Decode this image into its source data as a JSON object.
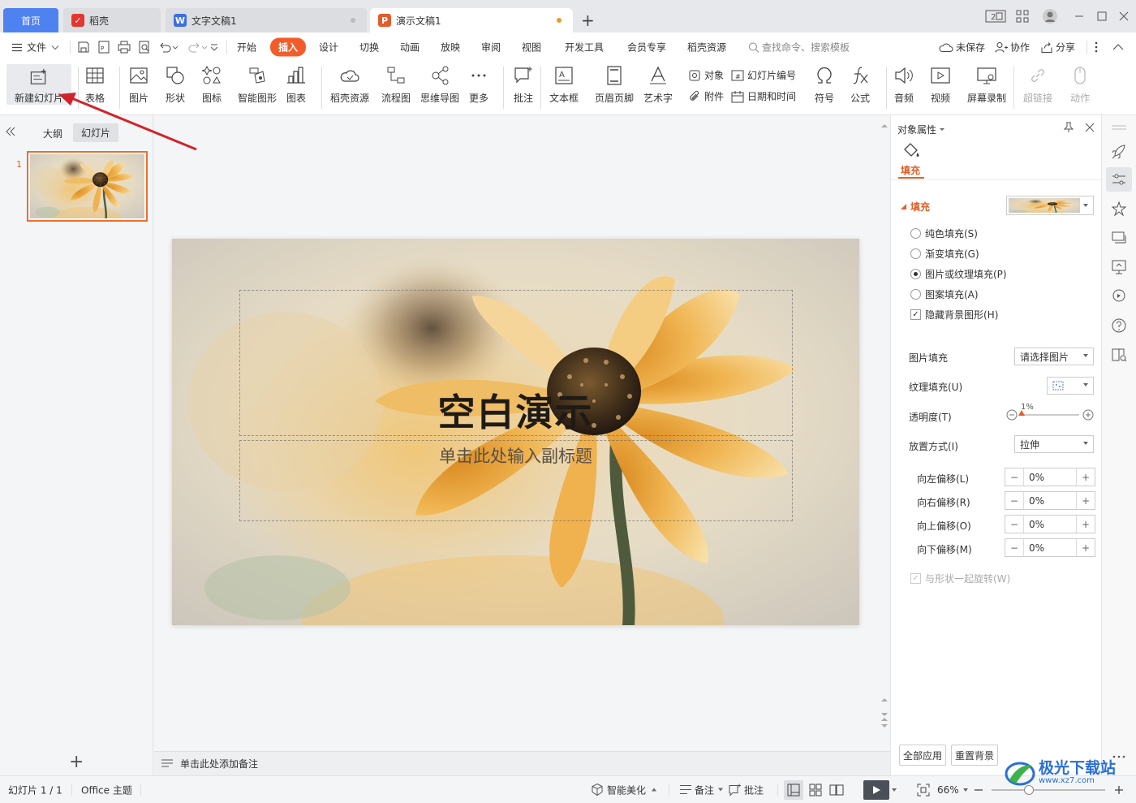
{
  "titlebar": {
    "tabs": [
      {
        "label": "首页"
      },
      {
        "label": "稻壳"
      },
      {
        "label": "文字文稿1"
      },
      {
        "label": "演示文稿1"
      }
    ],
    "new_tab_symbol": "+"
  },
  "menu": {
    "file": "文件",
    "items": [
      "开始",
      "插入",
      "设计",
      "切换",
      "动画",
      "放映",
      "审阅",
      "视图",
      "开发工具",
      "会员专享",
      "稻壳资源"
    ],
    "active": "插入",
    "search_placeholder": "查找命令、搜索模板",
    "unsaved": "未保存",
    "collaborate": "协作",
    "share": "分享"
  },
  "ribbon": {
    "new_slide": "新建幻灯片",
    "table": "表格",
    "picture": "图片",
    "shape": "形状",
    "icon": "图标",
    "smartart": "智能图形",
    "chart": "图表",
    "docer_resources": "稻壳资源",
    "flowchart": "流程图",
    "mindmap": "思维导图",
    "more": "更多",
    "comment": "批注",
    "textbox": "文本框",
    "header_footer": "页眉页脚",
    "wordart": "艺术字",
    "object": "对象",
    "attachment": "附件",
    "slide_number": "幻灯片编号",
    "datetime": "日期和时间",
    "symbol": "符号",
    "formula": "公式",
    "audio": "音频",
    "video": "视频",
    "screen_record": "屏幕录制",
    "hyperlink": "超链接",
    "action": "动作"
  },
  "left_panel": {
    "tab_outline": "大纲",
    "tab_slides": "幻灯片",
    "slide_number": "1",
    "add_symbol": "+"
  },
  "slide": {
    "title": "空白演示",
    "subtitle": "单击此处输入副标题"
  },
  "notes": {
    "placeholder": "单击此处添加备注"
  },
  "right_panel": {
    "header": "对象属性",
    "fill_tab": "填充",
    "fill_section": "填充",
    "options": [
      {
        "label": "纯色填充(S)",
        "selected": false
      },
      {
        "label": "渐变填充(G)",
        "selected": false
      },
      {
        "label": "图片或纹理填充(P)",
        "selected": true
      },
      {
        "label": "图案填充(A)",
        "selected": false
      }
    ],
    "hide_bg_graphics": "隐藏背景图形(H)",
    "picture_fill_label": "图片填充",
    "picture_fill_value": "请选择图片",
    "texture_fill_label": "纹理填充(U)",
    "transparency_label": "透明度(T)",
    "transparency_value": "1%",
    "transparency_fraction": 0.01,
    "placement_label": "放置方式(I)",
    "placement_value": "拉伸",
    "offsets": [
      {
        "label": "向左偏移(L)",
        "value": "0%"
      },
      {
        "label": "向右偏移(R)",
        "value": "0%"
      },
      {
        "label": "向上偏移(O)",
        "value": "0%"
      },
      {
        "label": "向下偏移(M)",
        "value": "0%"
      }
    ],
    "rotate_with_shape": "与形状一起旋转(W)",
    "apply_all": "全部应用",
    "reset_bg": "重置背景"
  },
  "status": {
    "slide_count": "幻灯片 1 / 1",
    "theme": "Office 主题",
    "smart_beautify": "智能美化",
    "notes": "备注",
    "comments": "批注",
    "zoom": "66%"
  },
  "watermark": {
    "text": "极光下载站",
    "url": "www.xz7.com"
  },
  "colors": {
    "accent": "#f25c2a",
    "home_tab": "#4e82f0",
    "annotation_arrow": "#d0242a"
  }
}
